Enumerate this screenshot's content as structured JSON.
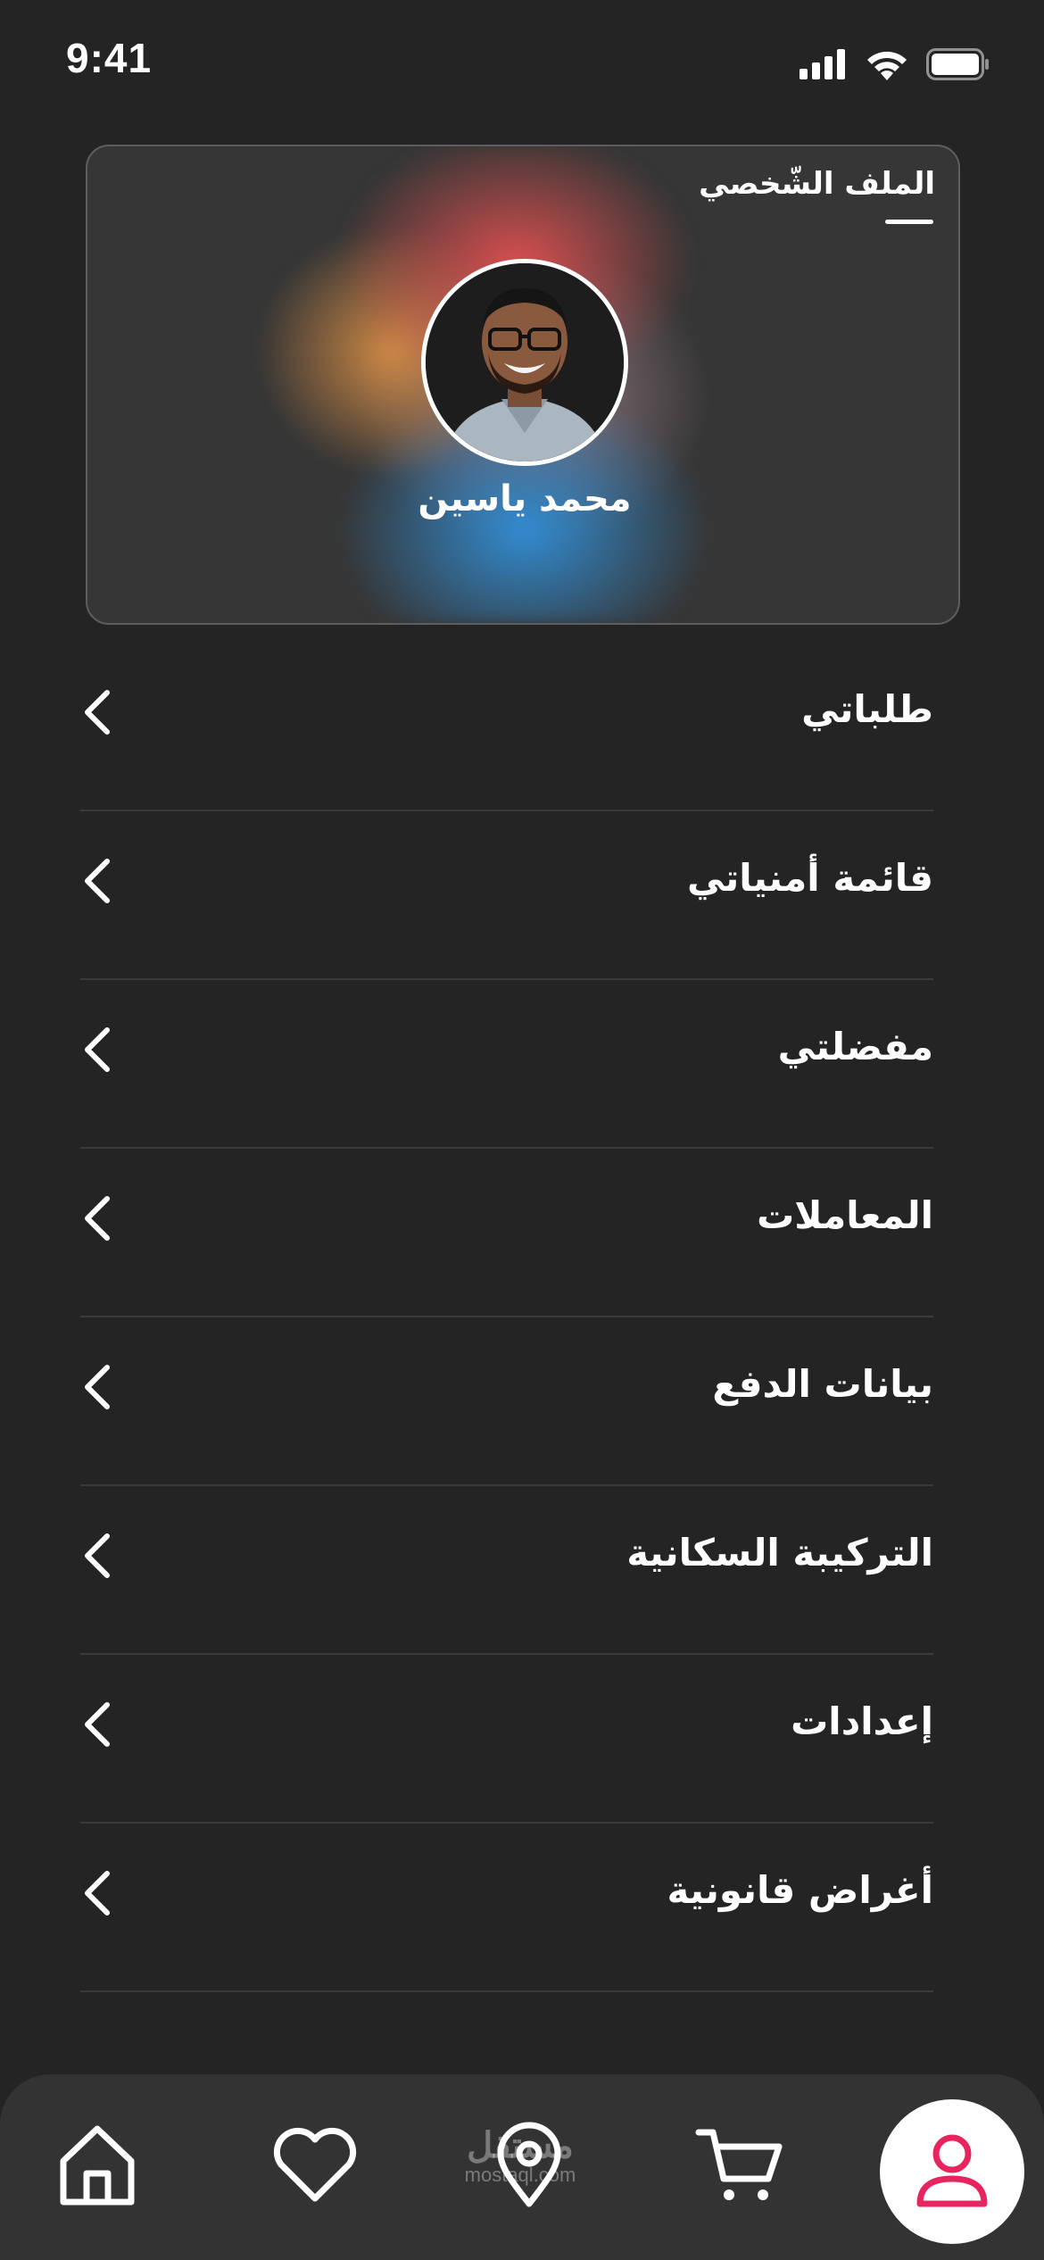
{
  "status_bar": {
    "time": "9:41",
    "icons": [
      "cellular-signal-icon",
      "wifi-icon",
      "battery-icon"
    ]
  },
  "profile_card": {
    "title": "الملف الشّخصي",
    "user_name": "محمد ياسين"
  },
  "menu": {
    "items": [
      {
        "label": "طلباتي",
        "icon": "chevron-left-icon"
      },
      {
        "label": "قائمة أمنياتي",
        "icon": "chevron-left-icon"
      },
      {
        "label": "مفضلتي",
        "icon": "chevron-left-icon"
      },
      {
        "label": "المعاملات",
        "icon": "chevron-left-icon"
      },
      {
        "label": "بيانات الدفع",
        "icon": "chevron-left-icon"
      },
      {
        "label": "التركيبة السكانية",
        "icon": "chevron-left-icon"
      },
      {
        "label": "إعدادات",
        "icon": "chevron-left-icon"
      },
      {
        "label": "أغراض قانونية",
        "icon": "chevron-left-icon"
      }
    ]
  },
  "bottom_nav": {
    "items": [
      "home-icon",
      "heart-icon",
      "location-pin-icon",
      "cart-icon",
      "user-icon"
    ],
    "active": "user-icon",
    "active_color": "#e8245f"
  },
  "watermark": {
    "line1": "مستقل",
    "line2": "mostaql.com"
  },
  "colors": {
    "background": "#242424",
    "card_background": "#363636",
    "divider": "#3a3a3a",
    "nav_background": "#333333",
    "accent": "#e8245f"
  }
}
